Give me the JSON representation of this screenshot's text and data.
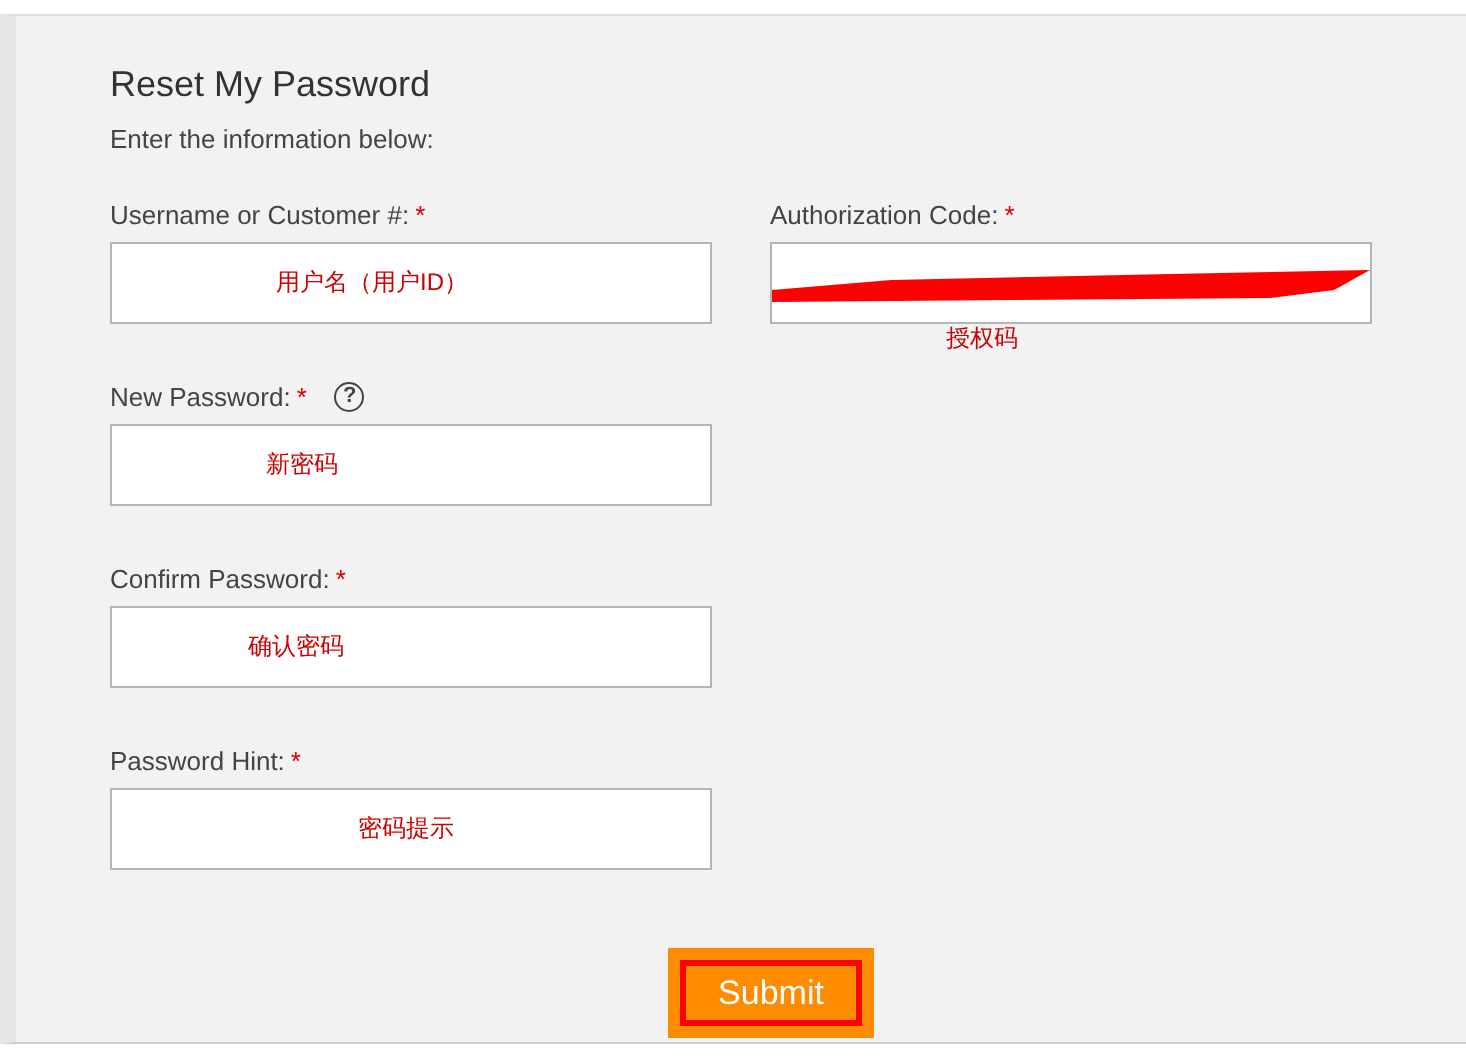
{
  "title": "Reset My Password",
  "subtitle": "Enter the information below:",
  "fields": [
    {
      "label": "Username or Customer #:",
      "required_mark": "*",
      "annotation": "用户名（用户ID）"
    },
    {
      "label": "New Password:",
      "required_mark": "*",
      "help": "?",
      "annotation": "新密码"
    },
    {
      "label": "Confirm Password:",
      "required_mark": "*",
      "annotation": "确认密码"
    },
    {
      "label": "Password Hint:",
      "required_mark": "*",
      "annotation": "密码提示"
    }
  ],
  "authorization": {
    "label": "Authorization Code:",
    "required_mark": "*",
    "redacted": true,
    "annotation": "授权码"
  },
  "submit": {
    "label": "Submit",
    "highlighted": true
  }
}
